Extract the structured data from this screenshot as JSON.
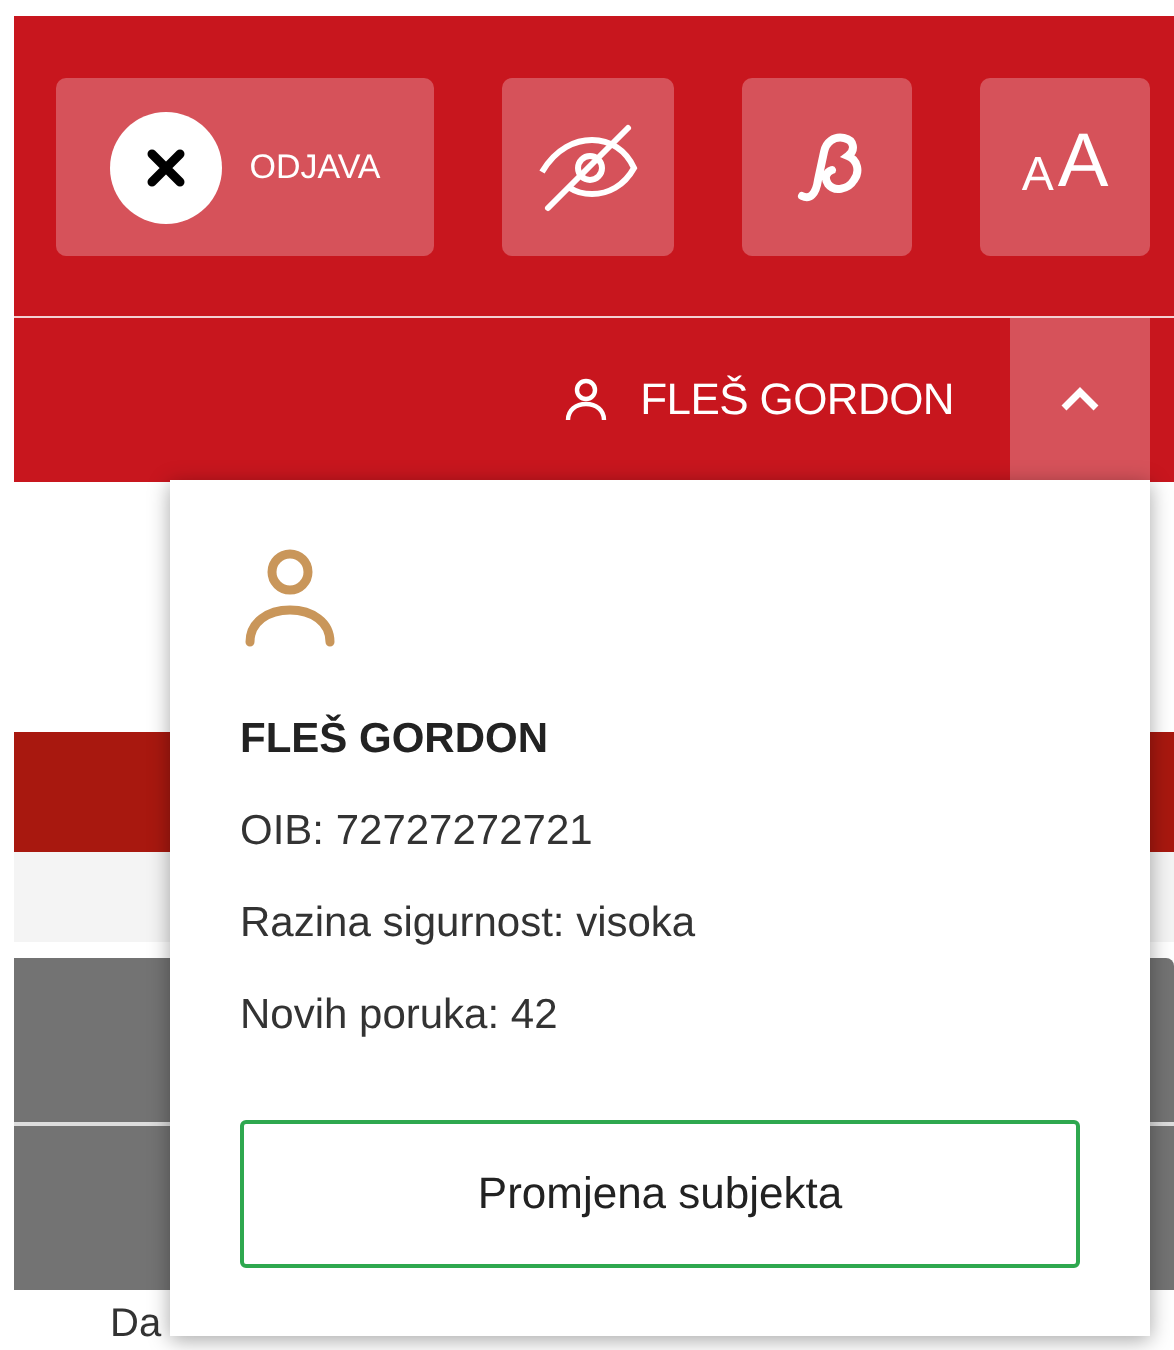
{
  "header": {
    "buttons": [
      {
        "kind": "logout",
        "label": "ODJAVA"
      },
      {
        "kind": "visibility"
      },
      {
        "kind": "font"
      },
      {
        "kind": "text_size",
        "small": "A",
        "large": "A"
      }
    ],
    "user": {
      "name": "FLEŠ GORDON",
      "expanded": true
    }
  },
  "user_menu": {
    "name": "FLEŠ GORDON",
    "lines": [
      "OIB: 72727272721",
      "Razina sigurnost: visoka",
      "Novih poruka: 42"
    ],
    "button": "Promjena subjekta"
  },
  "table": {
    "column_1": "Da"
  }
}
